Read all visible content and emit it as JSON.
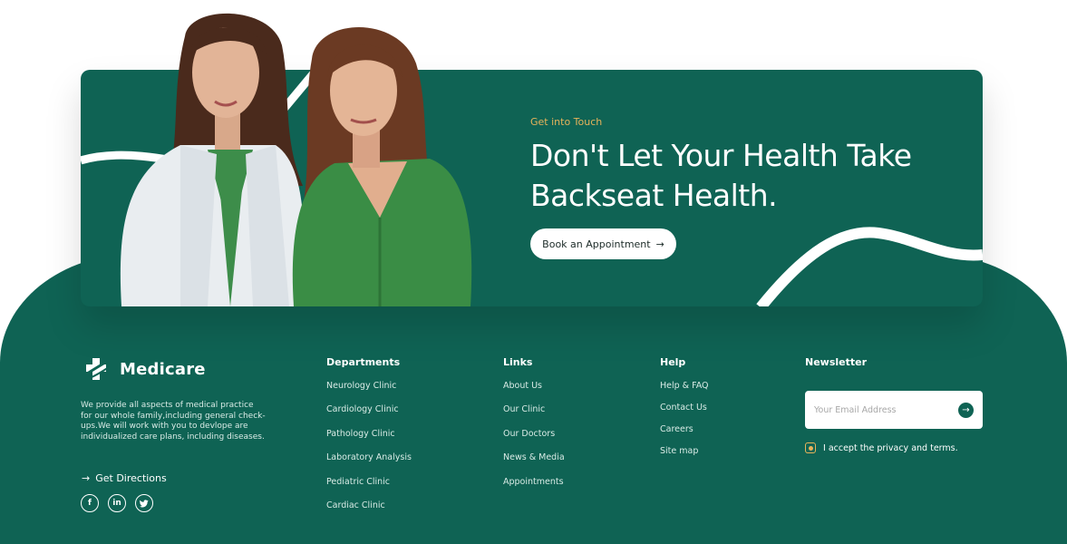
{
  "cta": {
    "eyebrow": "Get into Touch",
    "heading": "Don't Let Your Health Take Backseat Health.",
    "button_label": "Book an Appointment",
    "button_arrow": "→"
  },
  "brand": {
    "name": "Medicare",
    "description": "We provide all aspects of medical practice for our whole family,including general check-ups.We will work with you to devlope are individualized care plans, including diseases.",
    "directions_arrow": "→",
    "directions_label": "Get Directions",
    "socials": [
      {
        "icon": "facebook-icon",
        "glyph": "f"
      },
      {
        "icon": "linkedin-icon",
        "glyph": "in"
      },
      {
        "icon": "twitter-icon",
        "glyph": "t"
      }
    ]
  },
  "footer": {
    "departments": {
      "title": "Departments",
      "items": [
        "Neurology Clinic",
        "Cardiology Clinic",
        "Pathology Clinic",
        "Laboratory Analysis",
        "Pediatric Clinic",
        "Cardiac Clinic"
      ]
    },
    "links": {
      "title": "Links",
      "items": [
        "About Us",
        "Our Clinic",
        "Our Doctors",
        "News & Media",
        "Appointments"
      ]
    },
    "help": {
      "title": "Help",
      "items": [
        "Help & FAQ",
        "Contact Us",
        "Careers",
        "Site map"
      ]
    },
    "newsletter": {
      "title": "Newsletter",
      "placeholder": "Your Email Address",
      "send_arrow": "→",
      "accept_label": "I accept the privacy and terms."
    }
  },
  "colors": {
    "brand_green": "#0f6354",
    "accent_gold": "#e7b35a",
    "white": "#ffffff"
  }
}
